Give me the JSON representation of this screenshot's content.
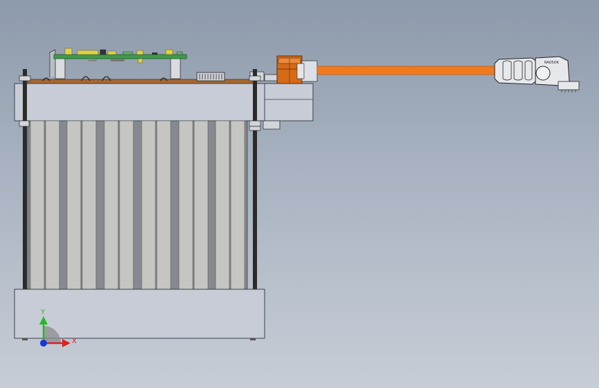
{
  "scene": {
    "view": "front",
    "background": {
      "top": "#8d9aab",
      "bottom": "#c7cdd6"
    },
    "components": [
      "pcb-board",
      "top-manifold-block",
      "heat-sink-fins",
      "threaded-rods",
      "bottom-base-block",
      "orange-connector-fitting",
      "orange-cable",
      "cable-plug"
    ],
    "colors": {
      "housing": "#c8ccd6",
      "housing_edge": "#3a3f4a",
      "fin": "#c5c5c1",
      "fin_gap": "#86898f",
      "pcb": "#3f9a4a",
      "pcb_chip": "#e2d23a",
      "cable": "#f07a1c",
      "fitting": "#d56a18",
      "rod": "#2b2b2b"
    }
  },
  "plug": {
    "brand_text": "RADSOK"
  },
  "triad": {
    "axes": [
      {
        "label": "Y",
        "color": "#22bb22"
      },
      {
        "label": "X",
        "color": "#dd2222"
      }
    ],
    "origin_color": "#1a35d6"
  }
}
